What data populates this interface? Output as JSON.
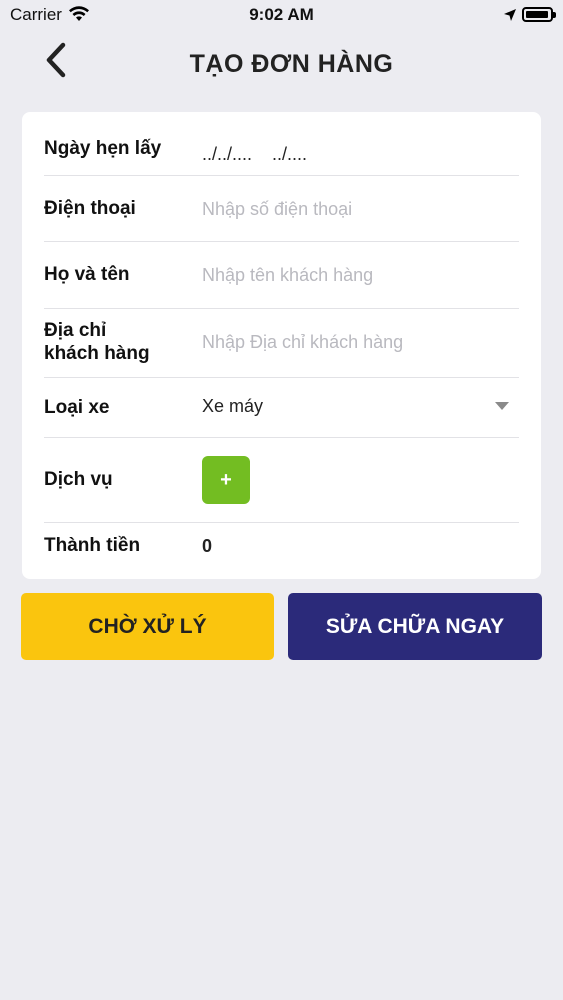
{
  "status_bar": {
    "carrier": "Carrier",
    "time": "9:02 AM",
    "battery_level": 0.95
  },
  "header": {
    "title": "TẠO ĐƠN HÀNG",
    "back_icon": "chevron-left-icon"
  },
  "form": {
    "pickup_date": {
      "label": "Ngày hẹn lấy",
      "value": "../../....    ../...."
    },
    "phone": {
      "label": "Điện thoại",
      "placeholder": "Nhập số điện thoại"
    },
    "full_name": {
      "label": "Họ và tên",
      "placeholder": "Nhập tên khách hàng"
    },
    "address": {
      "label_line1": "Địa chỉ",
      "label_line2": "khách hàng",
      "placeholder": "Nhập Địa chỉ khách hàng"
    },
    "vehicle_type": {
      "label": "Loại xe",
      "value": "Xe máy"
    },
    "service": {
      "label": "Dịch vụ",
      "add_label": "+"
    },
    "total": {
      "label": "Thành tiền",
      "value": "0"
    }
  },
  "actions": {
    "pending_label": "CHỜ XỬ LÝ",
    "repair_now_label": "SỬA CHỮA NGAY"
  },
  "colors": {
    "background": "#ececf1",
    "pending_button": "#fac50e",
    "repair_button": "#2b2a7a",
    "add_button": "#73bd22"
  }
}
